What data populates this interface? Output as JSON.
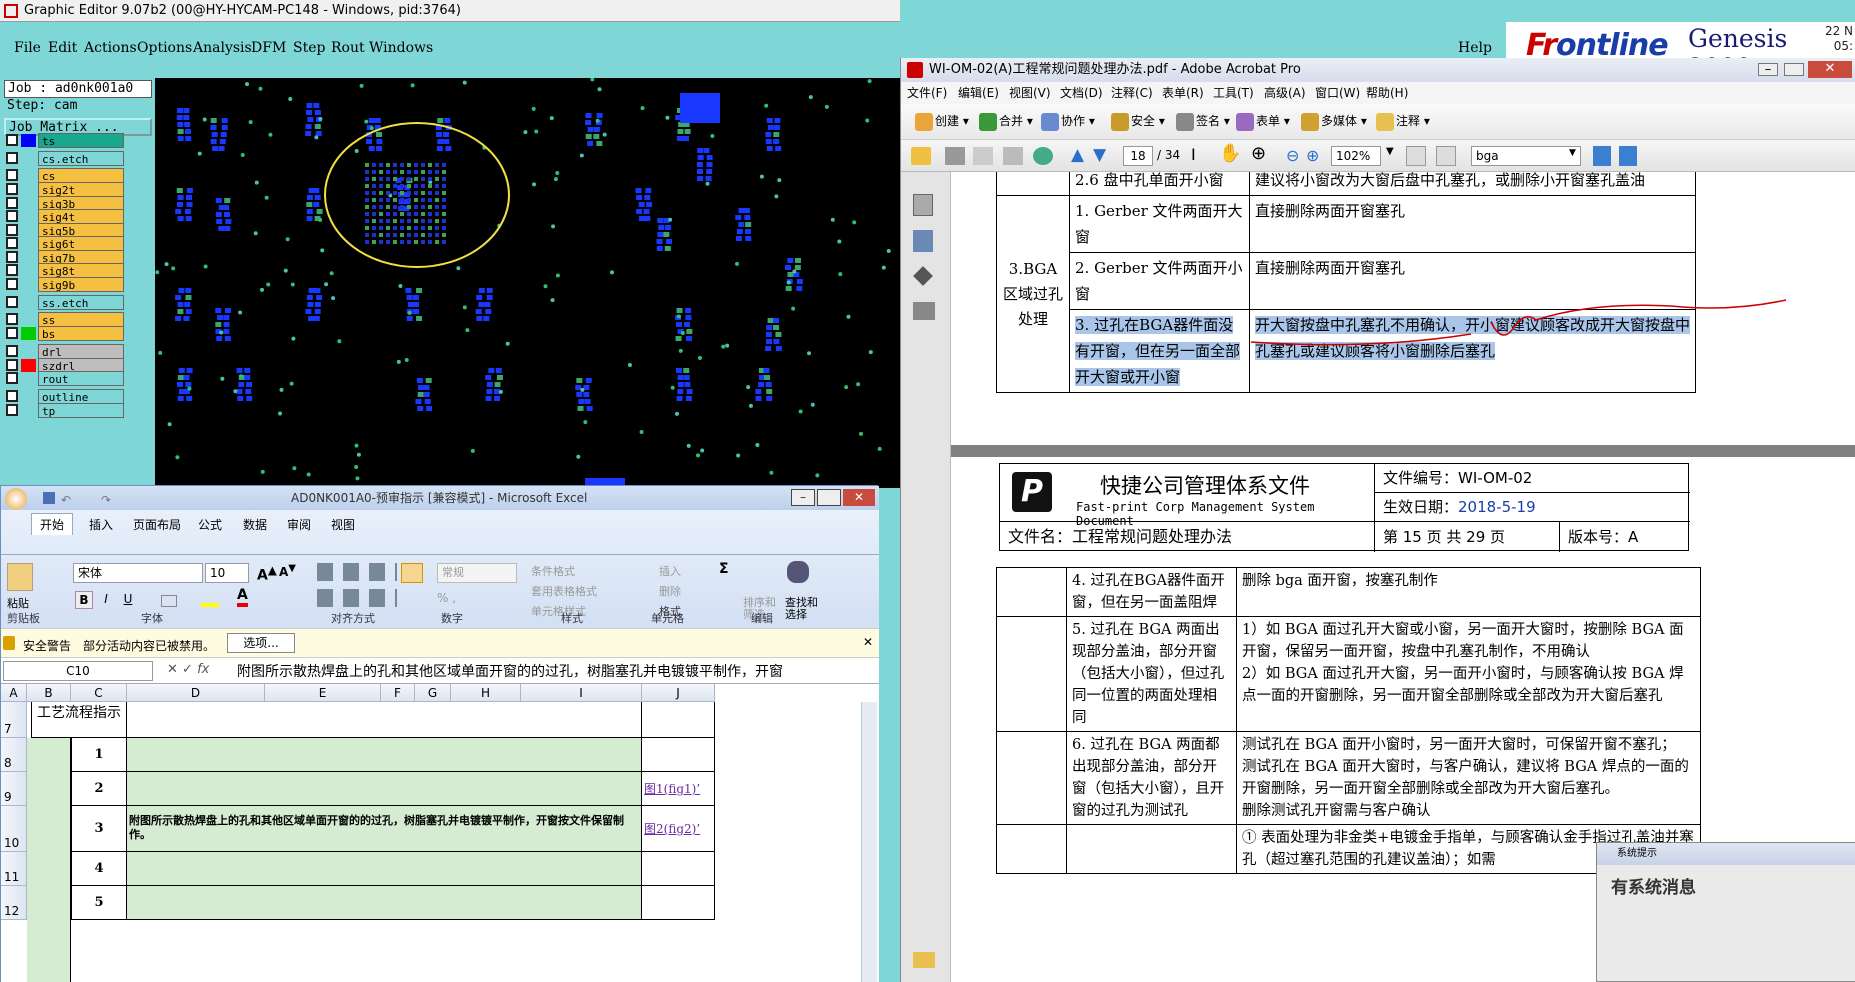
{
  "genesis": {
    "title": "Graphic Editor 9.07b2 (00@HY-HYCAM-PC148 - Windows, pid:3764)",
    "menu": [
      "File",
      "Edit",
      "Actions",
      "Options",
      "Analysis",
      "DFM",
      "Step",
      "Rout",
      "Windows"
    ],
    "help": "Help",
    "logo_front": "Fr",
    "logo_rest": "ontline",
    "logo_product": "Genesis 2000",
    "clock_top": "22 N",
    "clock_bottom": "05:",
    "job": "Job : ad0nk001a0",
    "step": "Step: cam",
    "job_matrix": "Job Matrix ...",
    "layers": [
      {
        "name": "ts",
        "color": "#0000ff"
      },
      {
        "name": "cs.etch",
        "color": ""
      },
      {
        "name": "cs",
        "color": ""
      },
      {
        "name": "sig2t",
        "color": ""
      },
      {
        "name": "sig3b",
        "color": ""
      },
      {
        "name": "sig4t",
        "color": ""
      },
      {
        "name": "sig5b",
        "color": ""
      },
      {
        "name": "sig6t",
        "color": ""
      },
      {
        "name": "sig7b",
        "color": ""
      },
      {
        "name": "sig8t",
        "color": ""
      },
      {
        "name": "sig9b",
        "color": ""
      },
      {
        "name": "ss.etch",
        "color": ""
      },
      {
        "name": "ss",
        "color": ""
      },
      {
        "name": "bs",
        "color": "#00cc00"
      },
      {
        "name": "drl",
        "color": ""
      },
      {
        "name": "szdrl",
        "color": "#ff0000"
      },
      {
        "name": "rout",
        "color": ""
      },
      {
        "name": "outline",
        "color": ""
      },
      {
        "name": "tp",
        "color": ""
      }
    ]
  },
  "excel": {
    "title": "AD0NK001A0-预审指示 [兼容模式] - Microsoft Excel",
    "tabs": [
      "开始",
      "插入",
      "页面布局",
      "公式",
      "数据",
      "审阅",
      "视图"
    ],
    "font": "宋体",
    "size": "10",
    "number_format": "常规",
    "groups": [
      "剪贴板",
      "字体",
      "对齐方式",
      "数字",
      "样式",
      "单元格",
      "编辑"
    ],
    "paste": "粘贴",
    "style_btns": [
      "条件格式",
      "套用表格格式",
      "单元格样式"
    ],
    "cell_btns": [
      "插入",
      "删除",
      "格式"
    ],
    "edit_btns": [
      "排序和\n筛选",
      "查找和\n选择"
    ],
    "security_label": "安全警告",
    "security_msg": "部分活动内容已被禁用。",
    "security_btn": "选项...",
    "namebox": "C10",
    "formula": "附图所示散热焊盘上的孔和其他区域单面开窗的的过孔，树脂塞孔并电镀镀平制作，开窗",
    "cols": [
      "A",
      "B",
      "C",
      "D",
      "E",
      "F",
      "G",
      "H",
      "I",
      "J"
    ],
    "rows": [
      {
        "num": "7",
        "b": "工艺流程指示",
        "c": "",
        "j": ""
      },
      {
        "num": "8",
        "b": "1",
        "c": "",
        "j": ""
      },
      {
        "num": "9",
        "b": "2",
        "c": "",
        "j": "图1(fig1)’"
      },
      {
        "num": "10",
        "b": "3",
        "c": "附图所示散热焊盘上的孔和其他区域单面开窗的的过孔，树脂塞孔并电镀镀平制作，开窗按文件保留制作。",
        "j": "图2(fig2)’"
      },
      {
        "num": "11",
        "b": "4",
        "c": "",
        "j": ""
      },
      {
        "num": "12",
        "b": "5",
        "c": "",
        "j": ""
      }
    ]
  },
  "acrobat": {
    "title": "WI-OM-02(A)工程常规问题处理办法.pdf - Adobe Acrobat Pro",
    "menu": [
      "文件(F)",
      "编辑(E)",
      "视图(V)",
      "文档(D)",
      "注释(C)",
      "表单(R)",
      "工具(T)",
      "高级(A)",
      "窗口(W)",
      "帮助(H)"
    ],
    "toolbar": [
      "创建",
      "合并",
      "协作",
      "安全",
      "签名",
      "表单",
      "多媒体",
      "注释"
    ],
    "page_current": "18",
    "page_total": "/ 34",
    "zoom": "102%",
    "search": "bga",
    "top_table": {
      "partial_row": [
        "2.6 盘中孔单面开小窗",
        "建议将小窗改为大窗后盘中孔塞孔，或删除小开窗塞孔盖油"
      ],
      "section": "3.BGA区域过孔处理",
      "rows": [
        [
          "1. Gerber 文件两面开大窗",
          "直接删除两面开窗塞孔"
        ],
        [
          "2. Gerber 文件两面开小窗",
          "直接删除两面开窗塞孔"
        ],
        [
          "3. 过孔在BGA器件面没有开窗，但在另一面全部开大窗或开小窗",
          "开大窗按盘中孔塞孔不用确认，开小窗建议顾客改成开大窗按盘中孔塞孔或建议顾客将小窗删除后塞孔"
        ]
      ]
    },
    "header": {
      "company": "快捷公司管理体系文件",
      "company_en": "Fast-print Corp Management System Document",
      "doc_no": "文件编号：WI-OM-02",
      "date_label": "生效日期：",
      "date": "2018-5-19",
      "file_name": "文件名：工程常规问题处理办法",
      "page": "第 15 页 共 29 页",
      "version": "版本号：A"
    },
    "bottom_table": [
      [
        "4. 过孔在BGA器件面开窗，但在另一面盖阻焊",
        "删除 bga 面开窗，按塞孔制作"
      ],
      [
        "5. 过孔在 BGA 两面出现部分盖油，部分开窗（包括大小窗），但过孔同一位置的两面处理相同",
        "1）如 BGA 面过孔开大窗或小窗，另一面开大窗时，按删除 BGA 面开窗，保留另一面开窗，按盘中孔塞孔制作，不用确认\n2）如 BGA 面过孔开大窗，另一面开小窗时，与顾客确认按 BGA 焊点一面的开窗删除，另一面开窗全部删除或全部改为开大窗后塞孔"
      ],
      [
        "6. 过孔在 BGA 两面都出现部分盖油，部分开窗（包括大小窗），且开窗的过孔为测试孔",
        "测试孔在 BGA 面开小窗时，另一面开大窗时，可保留开窗不塞孔；\n测试孔在 BGA 面开大窗时，与客户确认，建议将 BGA 焊点的一面的开窗删除，另一面开窗全部删除或全部改为开大窗后塞孔。\n删除测试孔开窗需与客户确认"
      ],
      [
        "",
        "① 表面处理为非金类+电镀金手指单，与顾客确认金手指过孔盖油并塞孔（超过塞孔范围的孔建议盖油）；如需"
      ]
    ],
    "popup_title": "系统提示",
    "popup_body": "有系统消息"
  }
}
